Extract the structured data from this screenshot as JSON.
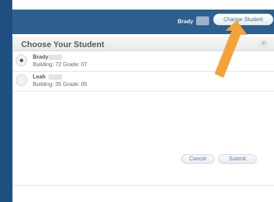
{
  "header": {
    "student_name": "Brady",
    "change_student_label": "Change Student"
  },
  "dialog": {
    "title": "Choose Your Student",
    "close_label": "×",
    "students": [
      {
        "name": "Brady",
        "detail": "Building: 72 Grade: 07",
        "selected": true
      },
      {
        "name": "Leah",
        "detail": "Building: 35 Grade: 05",
        "selected": false
      }
    ],
    "buttons": {
      "cancel": "Cancel",
      "submit": "Submit"
    }
  },
  "colors": {
    "top_bar": "#2d5f8f",
    "accent_arrow": "#f2a33a"
  },
  "icons": {
    "close": "close-icon",
    "arrow": "arrow-pointer-icon"
  }
}
